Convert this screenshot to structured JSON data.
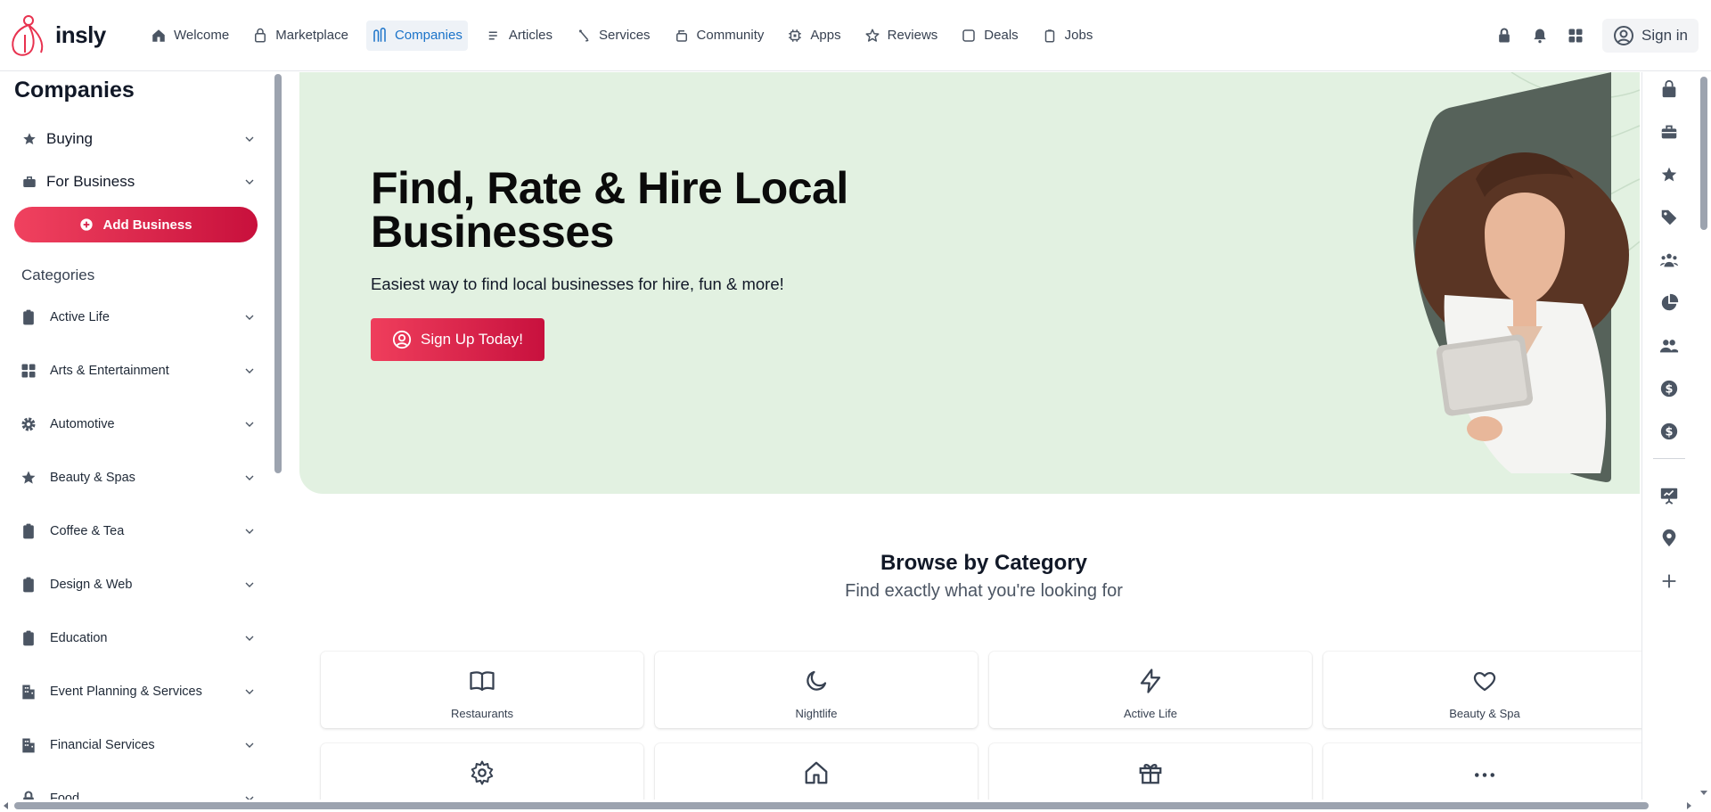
{
  "brand": {
    "name": "insly",
    "accent": "#e8324f",
    "active_nav": "#1a73c9",
    "hero_bg": "#e2f1e1"
  },
  "nav": [
    {
      "label": "Welcome",
      "icon": "home-icon"
    },
    {
      "label": "Marketplace",
      "icon": "bag-icon"
    },
    {
      "label": "Companies",
      "icon": "companies-icon",
      "active": true
    },
    {
      "label": "Articles",
      "icon": "list-icon"
    },
    {
      "label": "Services",
      "icon": "pen-icon"
    },
    {
      "label": "Community",
      "icon": "community-icon"
    },
    {
      "label": "Apps",
      "icon": "cpu-icon"
    },
    {
      "label": "Reviews",
      "icon": "star-icon"
    },
    {
      "label": "Deals",
      "icon": "square-icon"
    },
    {
      "label": "Jobs",
      "icon": "clipboard-icon"
    }
  ],
  "topright": {
    "signin_label": "Sign in",
    "icons": [
      "lock-icon",
      "bell-icon",
      "grid-icon",
      "user-circle-icon"
    ]
  },
  "sidebar": {
    "title": "Companies",
    "toggles": [
      {
        "label": "Buying",
        "icon": "star-icon"
      },
      {
        "label": "For Business",
        "icon": "briefcase-icon"
      }
    ],
    "add_button": "Add Business",
    "categories_heading": "Categories",
    "categories": [
      {
        "label": "Active Life",
        "icon": "clipboard-icon"
      },
      {
        "label": "Arts & Entertainment",
        "icon": "grid-icon"
      },
      {
        "label": "Automotive",
        "icon": "gear-icon"
      },
      {
        "label": "Beauty & Spas",
        "icon": "star-icon"
      },
      {
        "label": "Coffee & Tea",
        "icon": "clipboard-icon"
      },
      {
        "label": "Design & Web",
        "icon": "clipboard-icon"
      },
      {
        "label": "Education",
        "icon": "clipboard-icon"
      },
      {
        "label": "Event Planning & Services",
        "icon": "building-icon"
      },
      {
        "label": "Financial Services",
        "icon": "building-icon"
      },
      {
        "label": "Food",
        "icon": "lock-icon"
      }
    ]
  },
  "hero": {
    "title": "Find, Rate & Hire Local Businesses",
    "subtitle": "Easiest way to find local businesses for hire, fun & more!",
    "cta": "Sign Up Today!"
  },
  "browse": {
    "title": "Browse by Category",
    "subtitle": "Find exactly what you're looking for",
    "cards": [
      {
        "label": "Restaurants",
        "icon": "book-icon"
      },
      {
        "label": "Nightlife",
        "icon": "moon-icon"
      },
      {
        "label": "Active Life",
        "icon": "bolt-icon"
      },
      {
        "label": "Beauty & Spa",
        "icon": "heart-icon"
      },
      {
        "label": "",
        "icon": "gear-icon"
      },
      {
        "label": "",
        "icon": "home-icon"
      },
      {
        "label": "",
        "icon": "gift-icon"
      },
      {
        "label": "",
        "icon": "more-dots-icon"
      }
    ]
  },
  "rail": [
    "bag-icon",
    "briefcase-icon",
    "star-icon",
    "tag-icon",
    "people-group-icon",
    "pie-chart-icon",
    "users-icon",
    "dollar-icon",
    "dollar-icon",
    "presentation-icon",
    "map-pin-icon",
    "plus-icon"
  ]
}
